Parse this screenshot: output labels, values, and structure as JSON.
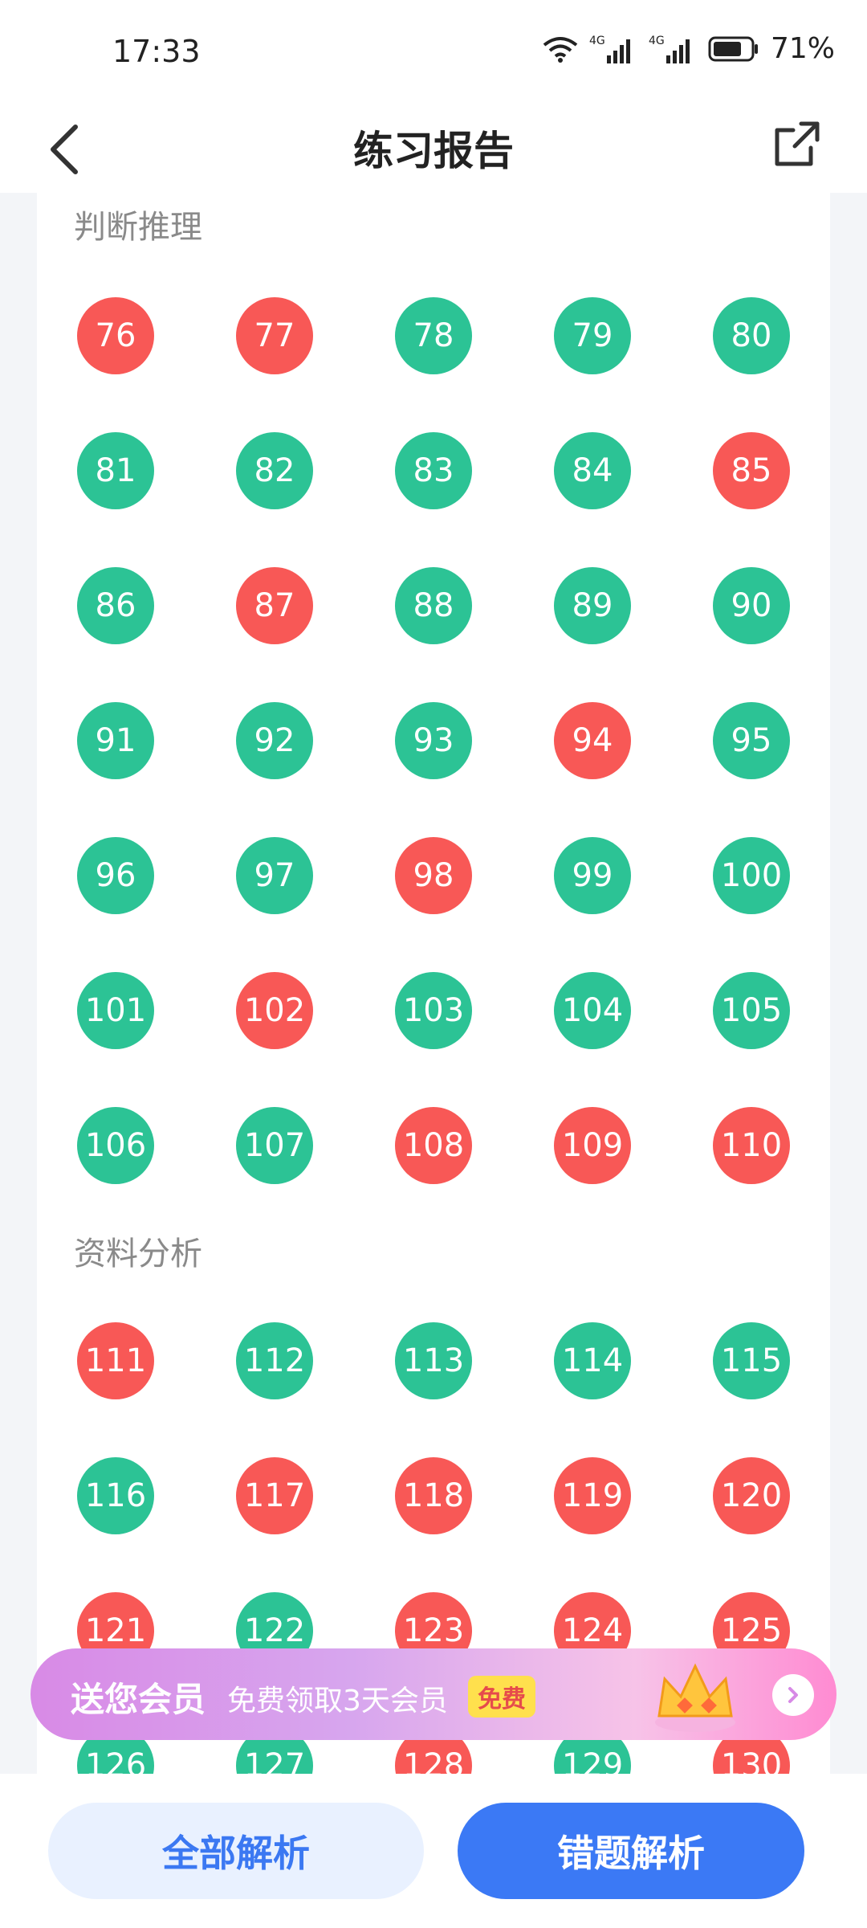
{
  "status": {
    "time": "17:33",
    "battery": "71%",
    "net1": "4G",
    "net2": "4G"
  },
  "header": {
    "title": "练习报告"
  },
  "sections": [
    {
      "title": "判断推理"
    },
    {
      "title": "资料分析"
    }
  ],
  "questions": {
    "76": "wrong",
    "77": "wrong",
    "78": "right",
    "79": "right",
    "80": "right",
    "81": "right",
    "82": "right",
    "83": "right",
    "84": "right",
    "85": "wrong",
    "86": "right",
    "87": "wrong",
    "88": "right",
    "89": "right",
    "90": "right",
    "91": "right",
    "92": "right",
    "93": "right",
    "94": "wrong",
    "95": "right",
    "96": "right",
    "97": "right",
    "98": "wrong",
    "99": "right",
    "100": "right",
    "101": "right",
    "102": "wrong",
    "103": "right",
    "104": "right",
    "105": "right",
    "106": "right",
    "107": "right",
    "108": "wrong",
    "109": "wrong",
    "110": "wrong",
    "111": "wrong",
    "112": "right",
    "113": "right",
    "114": "right",
    "115": "right",
    "116": "right",
    "117": "wrong",
    "118": "wrong",
    "119": "wrong",
    "120": "wrong",
    "121": "wrong",
    "122": "right",
    "123": "wrong",
    "124": "wrong",
    "125": "wrong",
    "126": "right",
    "127": "right",
    "128": "wrong",
    "129": "right",
    "130": "wrong"
  },
  "promo": {
    "title": "送您会员",
    "subtitle": "免费领取3天会员",
    "badge": "免费"
  },
  "buttons": {
    "all": "全部解析",
    "wrong": "错题解析"
  },
  "colors": {
    "right": "#2cc395",
    "wrong": "#f85856",
    "accent": "#3b79f5"
  }
}
